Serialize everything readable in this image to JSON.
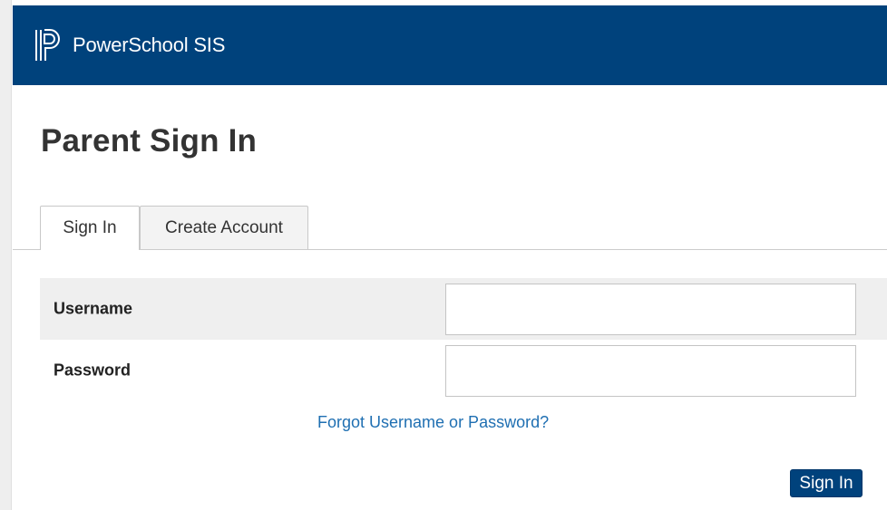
{
  "header": {
    "app_title": "PowerSchool SIS",
    "logo_icon": "powerschool-logo-icon",
    "background_color": "#00427c"
  },
  "page": {
    "title": "Parent Sign In"
  },
  "tabs": [
    {
      "label": "Sign In",
      "active": true
    },
    {
      "label": "Create Account",
      "active": false
    }
  ],
  "form": {
    "username": {
      "label": "Username",
      "value": "",
      "placeholder": ""
    },
    "password": {
      "label": "Password",
      "value": "",
      "placeholder": ""
    },
    "forgot_link": "Forgot Username or Password?",
    "submit_label": "Sign In"
  },
  "colors": {
    "brand": "#00427c",
    "link": "#1f6fb2"
  }
}
